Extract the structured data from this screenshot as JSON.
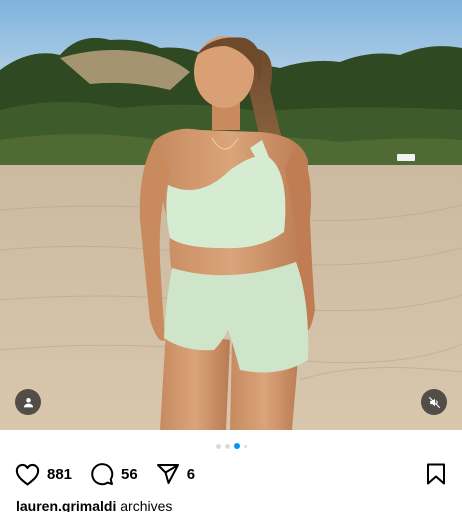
{
  "post": {
    "username": "lauren.grimaldi",
    "caption": "archives",
    "likes": "881",
    "comments": "56",
    "shares": "6",
    "carousel": {
      "total_dots": 4,
      "active_index": 2
    }
  },
  "icons": {
    "tag": "user-tag-icon",
    "mute": "speaker-muted-icon",
    "like": "heart-icon",
    "comment": "comment-bubble-icon",
    "share": "paper-plane-icon",
    "save": "bookmark-icon"
  },
  "colors": {
    "active_dot": "#0095f6",
    "inactive_dot": "#dbdbdb",
    "text": "#000000"
  }
}
